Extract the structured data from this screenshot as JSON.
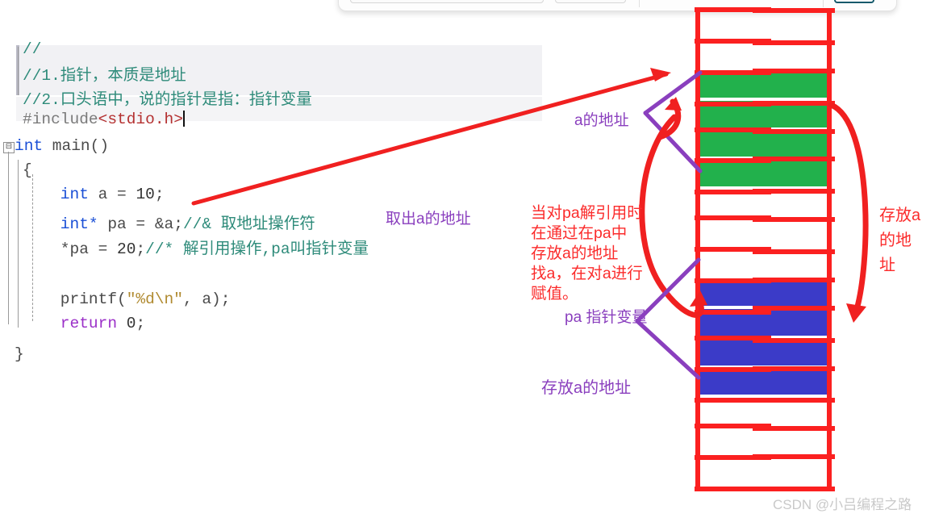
{
  "top_panel": {
    "field1_value": "",
    "field2_value": "",
    "button_label": ""
  },
  "editor": {
    "lines": [
      {
        "id": "l0",
        "segments": [
          {
            "cls": "cmt",
            "text": "//"
          }
        ]
      },
      {
        "id": "l1",
        "segments": [
          {
            "cls": "cmt",
            "text": "//1.指针，本质是地址"
          }
        ]
      },
      {
        "id": "l2",
        "segments": [
          {
            "cls": "cmt",
            "text": "//2.口头语中，说的指针是指：指针变量"
          }
        ]
      },
      {
        "id": "l3",
        "segments": [
          {
            "cls": "pp",
            "text": "#include"
          },
          {
            "cls": "inc",
            "text": "<stdio.h>"
          }
        ]
      },
      {
        "id": "l4",
        "segments": [
          {
            "cls": "kw",
            "text": "int"
          },
          {
            "cls": "plain",
            "text": " main()"
          }
        ]
      },
      {
        "id": "l5",
        "segments": [
          {
            "cls": "plain",
            "text": "{"
          }
        ]
      },
      {
        "id": "l6",
        "segments": [
          {
            "cls": "kw",
            "text": "    int"
          },
          {
            "cls": "plain",
            "text": " a = "
          },
          {
            "cls": "num",
            "text": "10"
          },
          {
            "cls": "plain",
            "text": ";"
          }
        ]
      },
      {
        "id": "l7",
        "segments": [
          {
            "cls": "kw",
            "text": "    int*"
          },
          {
            "cls": "plain",
            "text": " pa = &a;"
          },
          {
            "cls": "cmt",
            "text": "//& 取地址操作符"
          }
        ]
      },
      {
        "id": "l8",
        "segments": [
          {
            "cls": "plain",
            "text": "    *pa = "
          },
          {
            "cls": "num",
            "text": "20"
          },
          {
            "cls": "plain",
            "text": ";"
          },
          {
            "cls": "cmt",
            "text": "//* 解引用操作,pa叫指针变量"
          }
        ]
      },
      {
        "id": "l9",
        "segments": [
          {
            "cls": "plain",
            "text": ""
          }
        ]
      },
      {
        "id": "l10",
        "segments": [
          {
            "cls": "plain",
            "text": "    printf("
          },
          {
            "cls": "str",
            "text": "\"%d\\n\""
          },
          {
            "cls": "plain",
            "text": ", a);"
          }
        ]
      },
      {
        "id": "l11",
        "segments": [
          {
            "cls": "kw2",
            "text": "    return"
          },
          {
            "cls": "plain",
            "text": " "
          },
          {
            "cls": "num",
            "text": "0"
          },
          {
            "cls": "plain",
            "text": ";"
          }
        ]
      },
      {
        "id": "l12",
        "segments": [
          {
            "cls": "plain",
            "text": "}"
          }
        ]
      }
    ],
    "fold_marker": "⊟"
  },
  "annotations": {
    "take_address_of_a": "取出a的地址",
    "address_of_a": "a的地址",
    "pa_pointer_variable": "pa 指针变量",
    "store_address_of_a": "存放a的地址",
    "red_paragraph_lines": [
      "当对pa解引用时",
      "在通过在pa中",
      "存放a的地址",
      "找a，在对a进行",
      "赋值。"
    ],
    "right_red_lines": [
      "存放a",
      "的地",
      "址"
    ]
  },
  "memory_grid": {
    "cells": [
      {
        "index": 0,
        "fill": "none"
      },
      {
        "index": 1,
        "fill": "none"
      },
      {
        "index": 2,
        "fill": "green"
      },
      {
        "index": 3,
        "fill": "green"
      },
      {
        "index": 4,
        "fill": "green"
      },
      {
        "index": 5,
        "fill": "green"
      },
      {
        "index": 6,
        "fill": "none"
      },
      {
        "index": 7,
        "fill": "none"
      },
      {
        "index": 8,
        "fill": "none"
      },
      {
        "index": 9,
        "fill": "blue"
      },
      {
        "index": 10,
        "fill": "blue"
      },
      {
        "index": 11,
        "fill": "blue"
      },
      {
        "index": 12,
        "fill": "blue"
      },
      {
        "index": 13,
        "fill": "none"
      },
      {
        "index": 14,
        "fill": "none"
      },
      {
        "index": 15,
        "fill": "none"
      }
    ]
  },
  "colors": {
    "grid_stroke": "#fb2020",
    "green_cell": "#22b14c",
    "blue_cell": "#3b3bc8",
    "annotation_purple": "#8a3fbe",
    "annotation_red": "#fb2b2b",
    "watermark_grey": "#c9c9c9"
  },
  "watermark": "CSDN @小吕编程之路"
}
